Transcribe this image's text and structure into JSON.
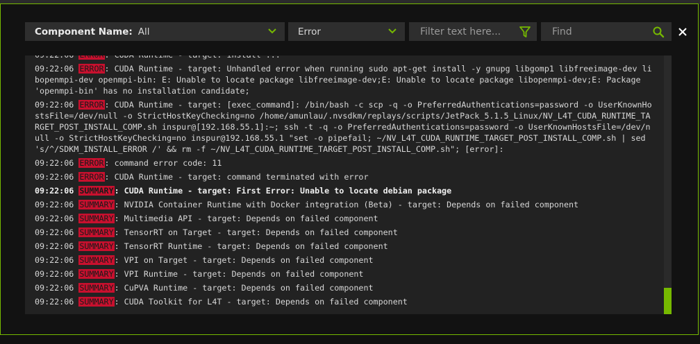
{
  "toolbar": {
    "component_label": "Component Name:",
    "component_value": "All",
    "level_value": "Error",
    "filter_placeholder": "Filter text here...",
    "find_placeholder": "Find"
  },
  "colors": {
    "accent": "#76b900",
    "tag_bg": "#c8102e"
  },
  "log": {
    "entries": [
      {
        "time": "09:22:06",
        "tag": "ERROR",
        "text": ": CUDA Runtime - target: install ..."
      },
      {
        "time": "09:22:06",
        "tag": "ERROR",
        "text": ": CUDA Runtime - target: Unhandled error when running sudo apt-get install -y gnupg libgomp1 libfreeimage-dev libopenmpi-dev openmpi-bin: E: Unable to locate package libfreeimage-dev;E: Unable to locate package libopenmpi-dev;E: Package 'openmpi-bin' has no installation candidate;"
      },
      {
        "time": "09:22:06",
        "tag": "ERROR",
        "text": ": CUDA Runtime - target: [exec_command]: /bin/bash -c scp -q -o PreferredAuthentications=password -o UserKnownHostsFile=/dev/null -o StrictHostKeyChecking=no /home/amunlau/.nvsdkm/replays/scripts/JetPack_5.1.5_Linux/NV_L4T_CUDA_RUNTIME_TARGET_POST_INSTALL_COMP.sh inspur@[192.168.55.1]:~; ssh -t -q -o PreferredAuthentications=password -o UserKnownHostsFile=/dev/null -o StrictHostKeyChecking=no inspur@192.168.55.1 \"set -o pipefail; ~/NV_L4T_CUDA_RUNTIME_TARGET_POST_INSTALL_COMP.sh | sed 's/^/SDKM_INSTALL_ERROR /' && rm -f ~/NV_L4T_CUDA_RUNTIME_TARGET_POST_INSTALL_COMP.sh\"; [error]:"
      },
      {
        "time": "09:22:06",
        "tag": "ERROR",
        "text": ": command error code: 11"
      },
      {
        "time": "09:22:06",
        "tag": "ERROR",
        "text": ": CUDA Runtime - target: command terminated with error"
      },
      {
        "time": "09:22:06",
        "tag": "SUMMARY",
        "text": ": CUDA Runtime - target: First Error: Unable to locate debian package",
        "bold": true
      },
      {
        "time": "09:22:06",
        "tag": "SUMMARY",
        "text": ": NVIDIA Container Runtime with Docker integration (Beta) - target: Depends on failed component"
      },
      {
        "time": "09:22:06",
        "tag": "SUMMARY",
        "text": ": Multimedia API - target: Depends on failed component"
      },
      {
        "time": "09:22:06",
        "tag": "SUMMARY",
        "text": ": TensorRT on Target - target: Depends on failed component"
      },
      {
        "time": "09:22:06",
        "tag": "SUMMARY",
        "text": ": TensorRT Runtime - target: Depends on failed component"
      },
      {
        "time": "09:22:06",
        "tag": "SUMMARY",
        "text": ": VPI on Target - target: Depends on failed component"
      },
      {
        "time": "09:22:06",
        "tag": "SUMMARY",
        "text": ": VPI Runtime - target: Depends on failed component"
      },
      {
        "time": "09:22:06",
        "tag": "SUMMARY",
        "text": ": CuPVA Runtime - target: Depends on failed component"
      },
      {
        "time": "09:22:06",
        "tag": "SUMMARY",
        "text": ": CUDA Toolkit for L4T - target: Depends on failed component"
      }
    ]
  }
}
